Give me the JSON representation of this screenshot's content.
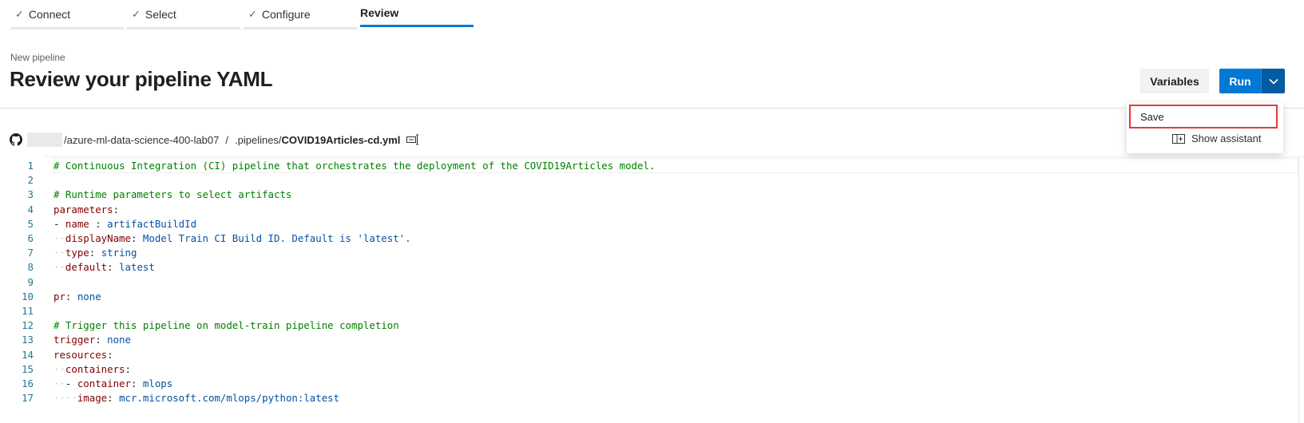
{
  "wizard": {
    "steps": [
      {
        "label": "Connect",
        "state": "done"
      },
      {
        "label": "Select",
        "state": "done"
      },
      {
        "label": "Configure",
        "state": "done"
      },
      {
        "label": "Review",
        "state": "active"
      }
    ]
  },
  "header": {
    "subtitle": "New pipeline",
    "title": "Review your pipeline YAML",
    "variables_label": "Variables",
    "run_label": "Run"
  },
  "run_menu": {
    "items": [
      {
        "label": "Save"
      }
    ]
  },
  "assistant_label": "Show assistant",
  "path": {
    "repo": "/azure-ml-data-science-400-lab07",
    "separator": "/",
    "folder": ".pipelines/",
    "file": "COVID19Articles-cd.yml"
  },
  "colors": {
    "accent": "#0078d4",
    "highlight_box": "#e03d3d",
    "comment": "#008000",
    "key": "#800000",
    "value": "#0451a5"
  },
  "code": [
    {
      "n": "1",
      "tokens": [
        {
          "t": "# Continuous Integration (CI) pipeline that orchestrates the deployment of the COVID19Articles model.",
          "c": "comment"
        }
      ]
    },
    {
      "n": "2",
      "tokens": []
    },
    {
      "n": "3",
      "tokens": [
        {
          "t": "# Runtime parameters to select artifacts",
          "c": "comment"
        }
      ]
    },
    {
      "n": "4",
      "tokens": [
        {
          "t": "parameters",
          "c": "key"
        },
        {
          "t": ":",
          "c": "plain"
        }
      ]
    },
    {
      "n": "5",
      "tokens": [
        {
          "t": "- ",
          "c": "plain"
        },
        {
          "t": "name",
          "c": "key"
        },
        {
          "t": " : ",
          "c": "plain"
        },
        {
          "t": "artifactBuildId",
          "c": "val"
        }
      ]
    },
    {
      "n": "6",
      "tokens": [
        {
          "t": "  ",
          "c": "ws"
        },
        {
          "t": "displayName",
          "c": "key"
        },
        {
          "t": ": ",
          "c": "plain"
        },
        {
          "t": "Model Train CI Build ID. Default is 'latest'.",
          "c": "val"
        }
      ]
    },
    {
      "n": "7",
      "tokens": [
        {
          "t": "  ",
          "c": "ws"
        },
        {
          "t": "type",
          "c": "key"
        },
        {
          "t": ": ",
          "c": "plain"
        },
        {
          "t": "string",
          "c": "val"
        }
      ]
    },
    {
      "n": "8",
      "tokens": [
        {
          "t": "  ",
          "c": "ws"
        },
        {
          "t": "default",
          "c": "key"
        },
        {
          "t": ": ",
          "c": "plain"
        },
        {
          "t": "latest",
          "c": "val"
        }
      ]
    },
    {
      "n": "9",
      "tokens": []
    },
    {
      "n": "10",
      "tokens": [
        {
          "t": "pr",
          "c": "key"
        },
        {
          "t": ": ",
          "c": "plain"
        },
        {
          "t": "none",
          "c": "val"
        }
      ]
    },
    {
      "n": "11",
      "tokens": []
    },
    {
      "n": "12",
      "tokens": [
        {
          "t": "# Trigger this pipeline on model-train pipeline completion",
          "c": "comment"
        }
      ]
    },
    {
      "n": "13",
      "tokens": [
        {
          "t": "trigger",
          "c": "key"
        },
        {
          "t": ": ",
          "c": "plain"
        },
        {
          "t": "none",
          "c": "val"
        }
      ]
    },
    {
      "n": "14",
      "tokens": [
        {
          "t": "resources",
          "c": "key"
        },
        {
          "t": ":",
          "c": "plain"
        }
      ]
    },
    {
      "n": "15",
      "tokens": [
        {
          "t": "  ",
          "c": "ws"
        },
        {
          "t": "containers",
          "c": "key"
        },
        {
          "t": ":",
          "c": "plain"
        }
      ]
    },
    {
      "n": "16",
      "tokens": [
        {
          "t": "  ",
          "c": "ws"
        },
        {
          "t": "- ",
          "c": "plain"
        },
        {
          "t": "container",
          "c": "key"
        },
        {
          "t": ": ",
          "c": "plain"
        },
        {
          "t": "mlops",
          "c": "val"
        }
      ]
    },
    {
      "n": "17",
      "tokens": [
        {
          "t": "    ",
          "c": "ws"
        },
        {
          "t": "image",
          "c": "key"
        },
        {
          "t": ": ",
          "c": "plain"
        },
        {
          "t": "mcr.microsoft.com/mlops/python:latest",
          "c": "val"
        }
      ]
    }
  ]
}
